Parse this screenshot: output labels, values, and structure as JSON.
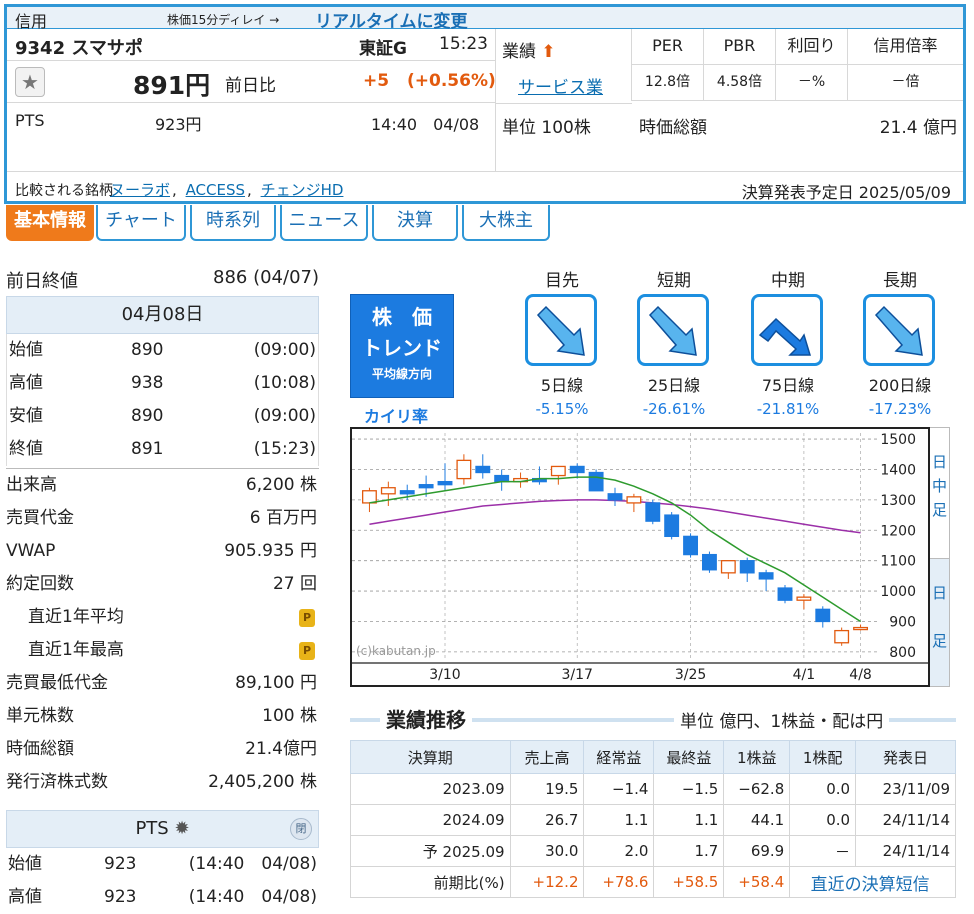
{
  "header": {
    "margin_type": "信用",
    "delay_note": "株価15分ディレイ →",
    "realtime_link": "リアルタイムに変更",
    "code_name": "9342 スマサポ",
    "market": "東証G",
    "time": "15:23",
    "price": "891円",
    "change_label": "前日比",
    "change": "+5",
    "change_pct": "(+0.56%)",
    "pts_label": "PTS",
    "pts_price": "923円",
    "pts_time": "14:40　04/08",
    "compare_label": "比較される銘柄",
    "compare": [
      "ヌーラボ",
      "ACCESS",
      "チェンジHD"
    ],
    "earnings_date": "決算発表予定日 2025/05/09",
    "gyoseki_label": "業績",
    "sector": "サービス業",
    "unit": "単位 100株",
    "metrics_headers": [
      "PER",
      "PBR",
      "利回り",
      "信用倍率"
    ],
    "metrics_values": [
      "12.8倍",
      "4.58倍",
      "－%",
      "－倍"
    ],
    "mcap_label": "時価総額",
    "mcap": "21.4 億円"
  },
  "tabs": [
    "基本情報",
    "チャート",
    "時系列",
    "ニュース",
    "決算",
    "大株主"
  ],
  "left": {
    "prev_close_label": "前日終値",
    "prev_close": "886 (04/07)",
    "date": "04月08日",
    "ohlc": [
      {
        "label": "始値",
        "value": "890",
        "time": "(09:00)"
      },
      {
        "label": "高値",
        "value": "938",
        "time": "(10:08)"
      },
      {
        "label": "安値",
        "value": "890",
        "time": "(09:00)"
      },
      {
        "label": "終値",
        "value": "891",
        "time": "(15:23)"
      }
    ],
    "stats": [
      {
        "label": "出来高",
        "value": "6,200 株"
      },
      {
        "label": "売買代金",
        "value": "6 百万円"
      },
      {
        "label": "VWAP",
        "value": "905.935 円"
      },
      {
        "label": "約定回数",
        "value": "27 回"
      },
      {
        "label": "直近1年平均",
        "value": "",
        "locked": true
      },
      {
        "label": "直近1年最高",
        "value": "",
        "locked": true
      },
      {
        "label": "売買最低代金",
        "value": "89,100 円"
      },
      {
        "label": "単元株数",
        "value": "100 株"
      },
      {
        "label": "時価総額",
        "value": "21.4億円"
      },
      {
        "label": "発行済株式数",
        "value": "2,405,200 株"
      }
    ],
    "pts_title": "PTS",
    "pts_close": "閉",
    "pts_rows": [
      {
        "label": "始値",
        "value": "923",
        "time": "(14:40　04/08)"
      },
      {
        "label": "高値",
        "value": "923",
        "time": "(14:40　04/08)"
      }
    ]
  },
  "trend": {
    "badge": [
      "株　価",
      "トレンド",
      "平均線方向"
    ],
    "kairi_label": "カイリ率",
    "terms": [
      "目先",
      "短期",
      "中期",
      "長期"
    ],
    "ma_labels": [
      "5日線",
      "25日線",
      "75日線",
      "200日線"
    ],
    "kairi": [
      "-5.15%",
      "-26.61%",
      "-21.81%",
      "-17.23%"
    ],
    "directions": [
      "down-right",
      "down-right",
      "down-right-peak",
      "down-right"
    ]
  },
  "chart_data": {
    "type": "candlestick",
    "x_ticks": [
      "3/10",
      "3/17",
      "3/25",
      "4/1",
      "4/8"
    ],
    "y_ticks": [
      1500,
      1400,
      1300,
      1200,
      1100,
      1000,
      900,
      800
    ],
    "ylim": [
      770,
      1520
    ],
    "watermark": "(c)kabutan.jp",
    "side_labels": [
      "日",
      "中",
      "足",
      "日",
      "足"
    ],
    "candles": [
      {
        "o": 1290,
        "h": 1340,
        "l": 1260,
        "c": 1330
      },
      {
        "o": 1320,
        "h": 1360,
        "l": 1280,
        "c": 1340
      },
      {
        "o": 1330,
        "h": 1350,
        "l": 1300,
        "c": 1320
      },
      {
        "o": 1350,
        "h": 1380,
        "l": 1310,
        "c": 1340
      },
      {
        "o": 1360,
        "h": 1420,
        "l": 1330,
        "c": 1350
      },
      {
        "o": 1370,
        "h": 1450,
        "l": 1350,
        "c": 1430
      },
      {
        "o": 1410,
        "h": 1450,
        "l": 1370,
        "c": 1390
      },
      {
        "o": 1380,
        "h": 1400,
        "l": 1330,
        "c": 1360
      },
      {
        "o": 1360,
        "h": 1390,
        "l": 1340,
        "c": 1370
      },
      {
        "o": 1370,
        "h": 1410,
        "l": 1350,
        "c": 1360
      },
      {
        "o": 1380,
        "h": 1410,
        "l": 1350,
        "c": 1410
      },
      {
        "o": 1410,
        "h": 1420,
        "l": 1370,
        "c": 1390
      },
      {
        "o": 1390,
        "h": 1400,
        "l": 1330,
        "c": 1330
      },
      {
        "o": 1320,
        "h": 1340,
        "l": 1280,
        "c": 1300
      },
      {
        "o": 1290,
        "h": 1320,
        "l": 1260,
        "c": 1310
      },
      {
        "o": 1290,
        "h": 1300,
        "l": 1220,
        "c": 1230
      },
      {
        "o": 1250,
        "h": 1260,
        "l": 1170,
        "c": 1180
      },
      {
        "o": 1180,
        "h": 1190,
        "l": 1110,
        "c": 1120
      },
      {
        "o": 1120,
        "h": 1130,
        "l": 1060,
        "c": 1070
      },
      {
        "o": 1060,
        "h": 1100,
        "l": 1040,
        "c": 1100
      },
      {
        "o": 1100,
        "h": 1110,
        "l": 1030,
        "c": 1060
      },
      {
        "o": 1060,
        "h": 1070,
        "l": 1000,
        "c": 1040
      },
      {
        "o": 1010,
        "h": 1020,
        "l": 960,
        "c": 970
      },
      {
        "o": 970,
        "h": 990,
        "l": 940,
        "c": 980
      },
      {
        "o": 940,
        "h": 950,
        "l": 880,
        "c": 900
      },
      {
        "o": 830,
        "h": 880,
        "l": 820,
        "c": 870
      },
      {
        "o": 880,
        "h": 890,
        "l": 870,
        "c": 880
      }
    ],
    "ma_short": [
      1290,
      1300,
      1310,
      1320,
      1330,
      1340,
      1350,
      1360,
      1360,
      1370,
      1370,
      1375,
      1375,
      1365,
      1345,
      1320,
      1290,
      1250,
      1200,
      1160,
      1120,
      1090,
      1060,
      1020,
      980,
      940,
      900
    ],
    "ma_long": [
      1220,
      1230,
      1240,
      1250,
      1260,
      1270,
      1280,
      1285,
      1290,
      1295,
      1298,
      1300,
      1300,
      1298,
      1295,
      1290,
      1285,
      1278,
      1270,
      1260,
      1250,
      1240,
      1230,
      1220,
      1210,
      1200,
      1192
    ]
  },
  "performance": {
    "title": "業績推移",
    "unit": "単位 億円、1株益・配は円",
    "headers": [
      "決算期",
      "売上高",
      "経常益",
      "最終益",
      "1株益",
      "1株配",
      "発表日"
    ],
    "rows": [
      [
        "2023.09",
        "19.5",
        "−1.4",
        "−1.5",
        "−62.8",
        "0.0",
        "23/11/09"
      ],
      [
        "2024.09",
        "26.7",
        "1.1",
        "1.1",
        "44.1",
        "0.0",
        "24/11/14"
      ],
      [
        "予 2025.09",
        "30.0",
        "2.0",
        "1.7",
        "69.9",
        "－",
        "24/11/14"
      ]
    ],
    "yoy_label": "前期比(%)",
    "yoy": [
      "+12.2",
      "+78.6",
      "+58.5",
      "+58.4"
    ],
    "latest_link": "直近の決算短信"
  },
  "colors": {
    "accent": "#2f97d6",
    "up": "#e25a0e",
    "down": "#1c7be0",
    "tab_active": "#ef7a1b"
  }
}
